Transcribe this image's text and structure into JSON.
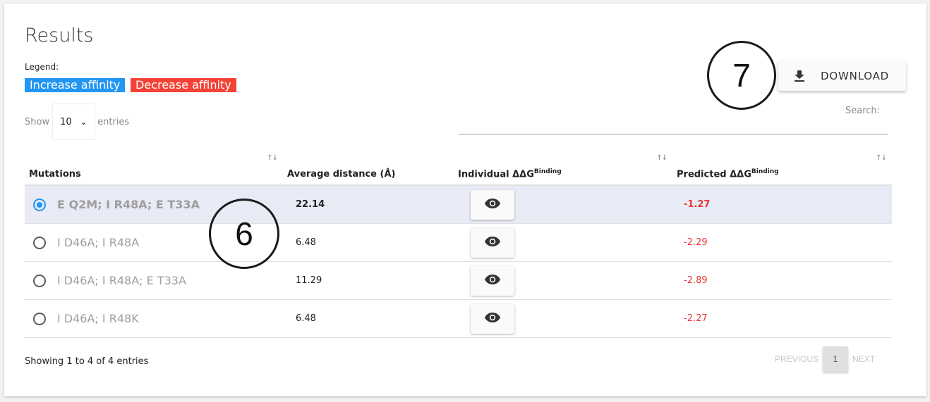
{
  "title": "Results",
  "legend": {
    "label": "Legend:",
    "items": [
      {
        "label": "Increase affinity",
        "color": "#2196f3"
      },
      {
        "label": "Decrease affinity",
        "color": "#f44336"
      }
    ]
  },
  "length_menu": {
    "prefix": "Show",
    "selected": "10",
    "suffix": "entries"
  },
  "download_button": {
    "label": "DOWNLOAD",
    "icon": "download-icon"
  },
  "search": {
    "label": "Search:",
    "value": ""
  },
  "annotations": [
    "7",
    "6"
  ],
  "table": {
    "columns": [
      {
        "label": "Mutations",
        "sortable": true
      },
      {
        "label": "Average distance (Å)",
        "sortable": false
      },
      {
        "label": "Individual ΔΔG",
        "sup": "Binding",
        "sortable": true
      },
      {
        "label": "Predicted ΔΔG",
        "sup": "Binding",
        "sortable": true
      }
    ],
    "sort_icon": "↑↓",
    "rows": [
      {
        "mutation": "E Q2M; I R48A; E T33A",
        "distance": "22.14",
        "predicted": "-1.27",
        "selected": true
      },
      {
        "mutation": "I D46A; I R48A",
        "distance": "6.48",
        "predicted": "-2.29",
        "selected": false
      },
      {
        "mutation": "I D46A; I R48A; E T33A",
        "distance": "11.29",
        "predicted": "-2.89",
        "selected": false
      },
      {
        "mutation": "I D46A; I R48K",
        "distance": "6.48",
        "predicted": "-2.27",
        "selected": false
      }
    ]
  },
  "info": "Showing 1 to 4 of 4 entries",
  "pagination": {
    "previous": "PREVIOUS",
    "current": "1",
    "next": "NEXT"
  }
}
